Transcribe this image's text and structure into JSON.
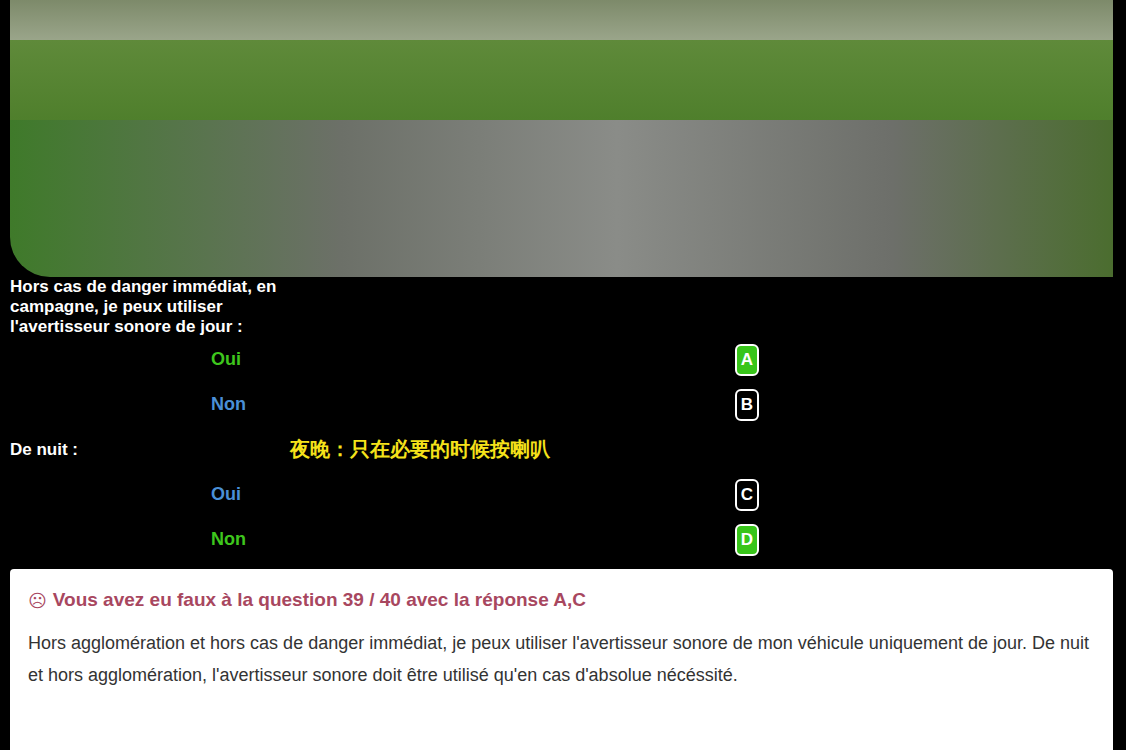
{
  "questions": [
    {
      "prompt": "Hors cas de danger immédiat, en campagne, je peux utiliser l'avertisseur sonore de jour :",
      "note": "",
      "options": [
        {
          "label": "Oui",
          "letter": "A",
          "correct": true
        },
        {
          "label": "Non",
          "letter": "B",
          "correct": false
        }
      ]
    },
    {
      "prompt": "De nuit :",
      "note": "夜晚：只在必要的时候按喇叭",
      "options": [
        {
          "label": "Oui",
          "letter": "C",
          "correct": false
        },
        {
          "label": "Non",
          "letter": "D",
          "correct": true
        }
      ]
    }
  ],
  "feedback": {
    "icon": "☹",
    "title": "Vous avez eu faux à la question 39 / 40 avec la réponse A,C",
    "text": "Hors agglomération et hors cas de danger immédiat, je peux utiliser l'avertisseur sonore de mon véhicule uniquement de jour. De nuit et hors agglomération, l'avertisseur sonore doit être utilisé qu'en cas d'absolue nécéssité."
  }
}
